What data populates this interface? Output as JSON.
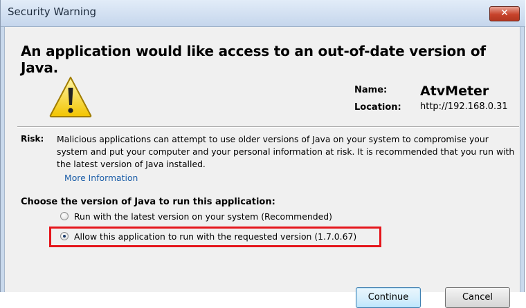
{
  "window": {
    "title": "Security Warning"
  },
  "headline": "An application would like access to an out-of-date version of Java.",
  "app_info": {
    "name_label": "Name:",
    "name_value": "AtvMeter",
    "location_label": "Location:",
    "location_value": "http://192.168.0.31"
  },
  "risk": {
    "label": "Risk:",
    "text": "Malicious applications can attempt to use older versions of Java on your system to compromise your system and put your computer and your personal information at risk. It is recommended that you run with the latest version of Java installed.",
    "more_info_link": "More Information"
  },
  "choice": {
    "heading": "Choose the version of Java to run this application:",
    "options": [
      {
        "label": "Run with the latest version on your system (Recommended)",
        "selected": false
      },
      {
        "label": "Allow this application to run with the requested version (1.7.0.67)",
        "selected": true
      }
    ]
  },
  "buttons": {
    "continue": "Continue",
    "cancel": "Cancel"
  },
  "icons": {
    "warning": "warning-triangle-icon",
    "close": "close-icon"
  },
  "colors": {
    "highlight": "#e5151b",
    "close_button": "#c7432b",
    "link": "#1c5ea8"
  }
}
